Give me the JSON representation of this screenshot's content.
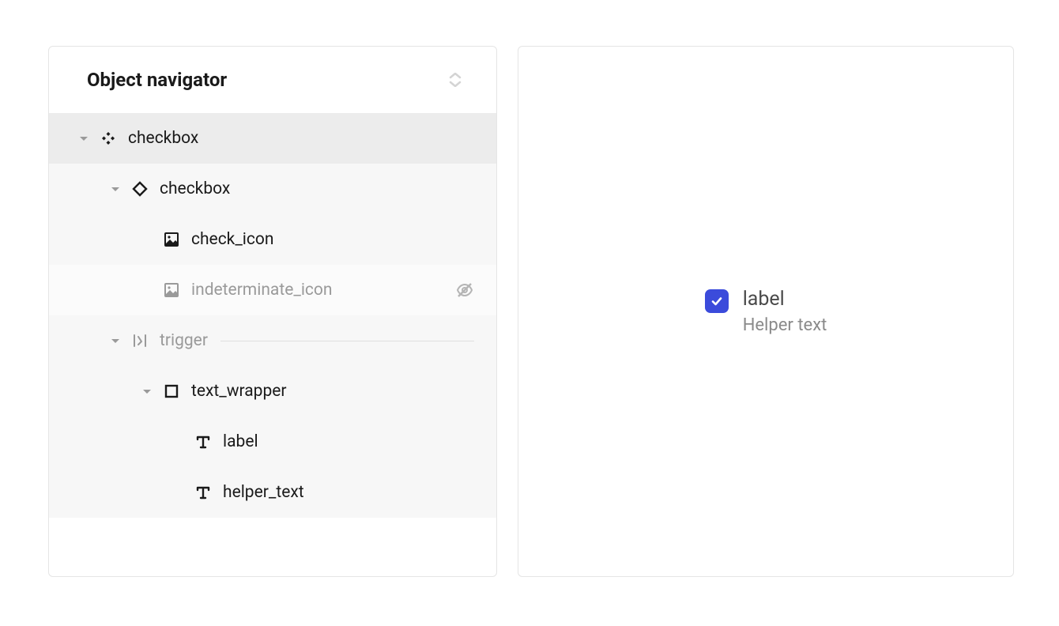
{
  "navigator": {
    "title": "Object navigator",
    "tree": {
      "root": {
        "label": "checkbox"
      },
      "checkbox_inner": {
        "label": "checkbox"
      },
      "check_icon": {
        "label": "check_icon"
      },
      "indeterminate_icon": {
        "label": "indeterminate_icon"
      },
      "trigger": {
        "label": "trigger"
      },
      "text_wrapper": {
        "label": "text_wrapper"
      },
      "label": {
        "label": "label"
      },
      "helper_text": {
        "label": "helper_text"
      }
    }
  },
  "preview": {
    "label": "label",
    "helper": "Helper text"
  }
}
